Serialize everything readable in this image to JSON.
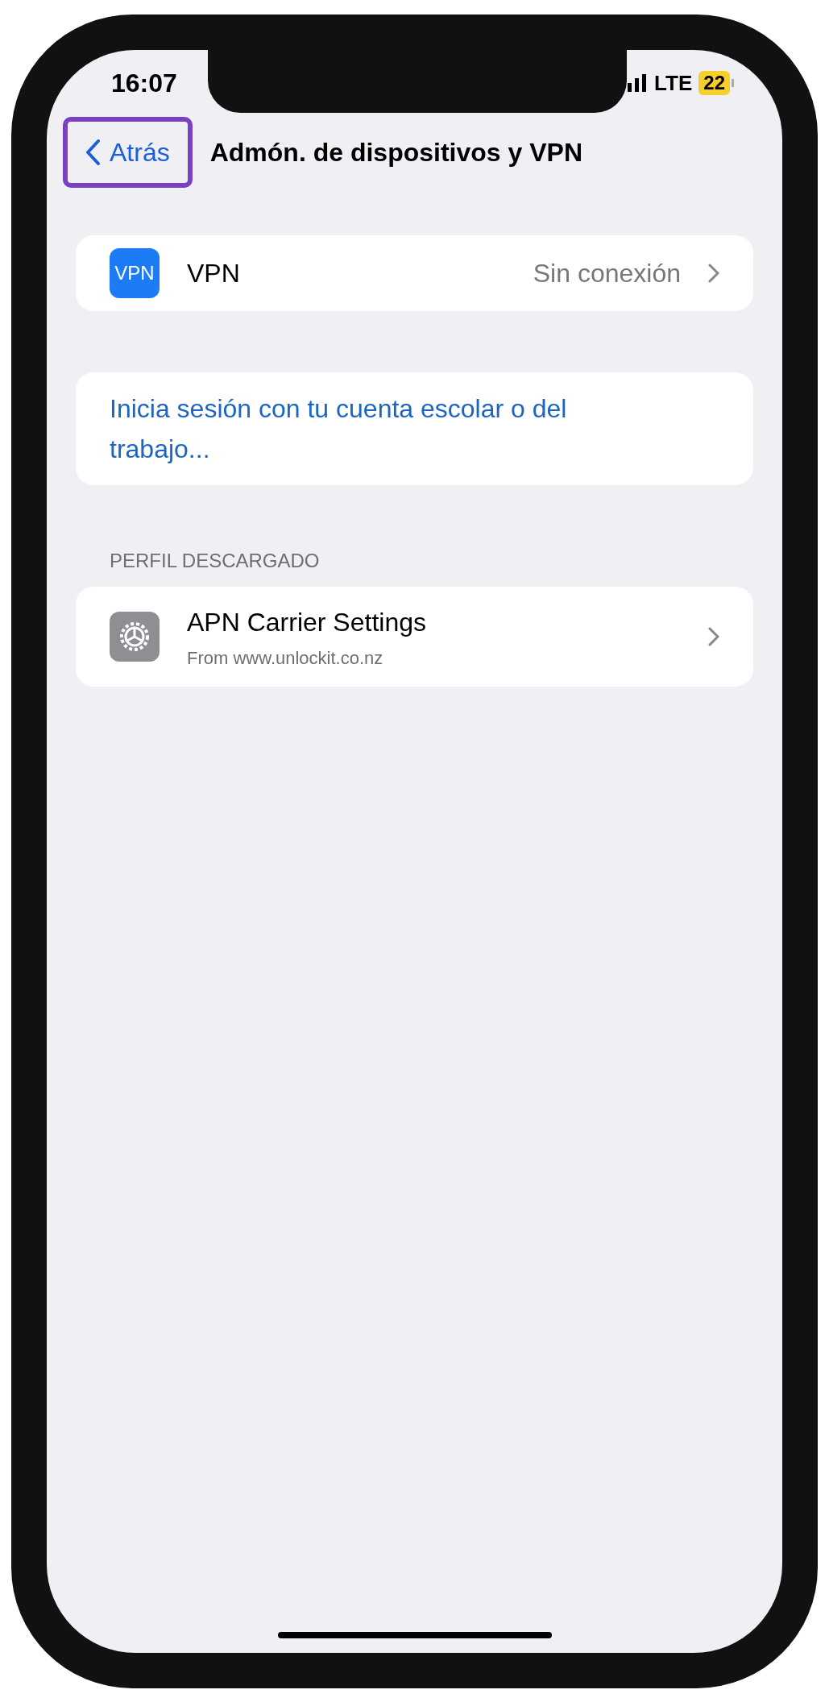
{
  "status_bar": {
    "time": "16:07",
    "network": "LTE",
    "battery": "22"
  },
  "nav": {
    "back": {
      "label": "Atrás",
      "highlighted": true
    },
    "title": "Admón. de dispositivos y VPN"
  },
  "vpn_row": {
    "label": "VPN",
    "icon_text": "VPN",
    "value": "Sin conexión"
  },
  "sign_in_link": "Inicia sesión con tu cuenta escolar o del trabajo...",
  "profile_section": {
    "header": "PERFIL DESCARGADO",
    "items": [
      {
        "title": "APN Carrier Settings",
        "subtitle": "From www.unlockit.co.nz"
      }
    ]
  }
}
